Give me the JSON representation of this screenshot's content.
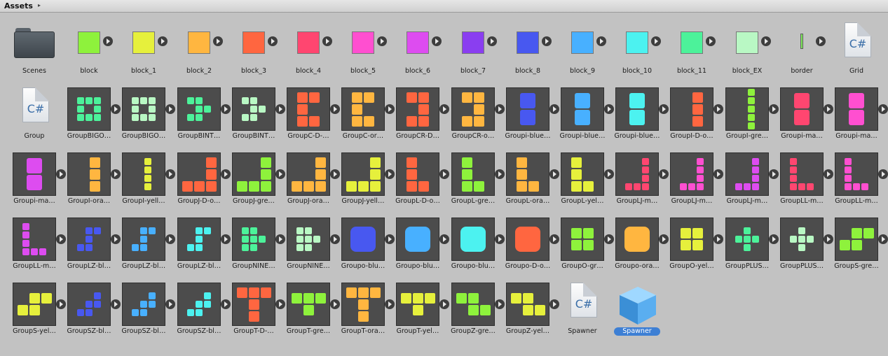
{
  "breadcrumb": {
    "label": "Assets",
    "arrow_icon": "chevron-right-icon"
  },
  "colors": {
    "block": "#8ef23c",
    "block_1": "#e6f03c",
    "block_2": "#ffb640",
    "block_3": "#ff6640",
    "block_4": "#ff4670",
    "block_5": "#ff4fd0",
    "block_6": "#dd4cf0",
    "block_7": "#8a3ef0",
    "block_8": "#4858f0",
    "block_9": "#48b0ff",
    "block_10": "#4cf2f0",
    "block_11": "#4cf29a",
    "block_EX": "#b9f8c4",
    "border": "#7ee85a",
    "selection": "#3d7fd4"
  },
  "assets": [
    {
      "label": "Scenes",
      "kind": "folder"
    },
    {
      "label": "block",
      "kind": "swatch",
      "color": "#8ef23c"
    },
    {
      "label": "block_1",
      "kind": "swatch",
      "color": "#e6f03c"
    },
    {
      "label": "block_2",
      "kind": "swatch",
      "color": "#ffb640"
    },
    {
      "label": "block_3",
      "kind": "swatch",
      "color": "#ff6640"
    },
    {
      "label": "block_4",
      "kind": "swatch",
      "color": "#ff4670"
    },
    {
      "label": "block_5",
      "kind": "swatch",
      "color": "#ff4fd0"
    },
    {
      "label": "block_6",
      "kind": "swatch",
      "color": "#dd4cf0"
    },
    {
      "label": "block_7",
      "kind": "swatch",
      "color": "#8a3ef0"
    },
    {
      "label": "block_8",
      "kind": "swatch",
      "color": "#4858f0"
    },
    {
      "label": "block_9",
      "kind": "swatch",
      "color": "#48b0ff"
    },
    {
      "label": "block_10",
      "kind": "swatch",
      "color": "#4cf2f0"
    },
    {
      "label": "block_11",
      "kind": "swatch",
      "color": "#4cf29a"
    },
    {
      "label": "block_EX",
      "kind": "swatch",
      "color": "#b9f8c4"
    },
    {
      "label": "border",
      "kind": "border"
    },
    {
      "label": "Grid",
      "kind": "script"
    },
    {
      "label": "Group",
      "kind": "script"
    },
    {
      "label": "GroupBIGO…",
      "kind": "tile",
      "shape": "bigo",
      "color": "#4cf29a"
    },
    {
      "label": "GroupBIGO…",
      "kind": "tile",
      "shape": "bigo",
      "color": "#b9f8c4"
    },
    {
      "label": "GroupBINT…",
      "kind": "tile",
      "shape": "bint",
      "color": "#4cf29a"
    },
    {
      "label": "GroupBINT…",
      "kind": "tile",
      "shape": "bint",
      "color": "#b9f8c4"
    },
    {
      "label": "GroupC-D-…",
      "kind": "tile",
      "shape": "c",
      "color": "#ff6640"
    },
    {
      "label": "GroupC-or…",
      "kind": "tile",
      "shape": "c",
      "color": "#ffb640"
    },
    {
      "label": "GroupCR-D…",
      "kind": "tile",
      "shape": "cr",
      "color": "#ff6640"
    },
    {
      "label": "GroupCR-o…",
      "kind": "tile",
      "shape": "cr",
      "color": "#ffb640"
    },
    {
      "label": "Groupi-blue…",
      "kind": "tile",
      "shape": "i2",
      "color": "#4858f0"
    },
    {
      "label": "Groupi-blue…",
      "kind": "tile",
      "shape": "i2",
      "color": "#48b0ff"
    },
    {
      "label": "Groupi-blue…",
      "kind": "tile",
      "shape": "i2",
      "color": "#4cf2f0"
    },
    {
      "label": "GroupI-D-o…",
      "kind": "tile",
      "shape": "i3",
      "color": "#ff6640"
    },
    {
      "label": "GroupI-gre…",
      "kind": "tile",
      "shape": "i5",
      "color": "#8ef23c"
    },
    {
      "label": "Groupi-ma…",
      "kind": "tile",
      "shape": "i2",
      "color": "#ff4670"
    },
    {
      "label": "Groupi-ma…",
      "kind": "tile",
      "shape": "i2",
      "color": "#ff4fd0"
    },
    {
      "label": "Groupi-ma…",
      "kind": "tile",
      "shape": "i2",
      "color": "#dd4cf0"
    },
    {
      "label": "GroupI-ora…",
      "kind": "tile",
      "shape": "i3",
      "color": "#ffb640"
    },
    {
      "label": "GroupI-yell…",
      "kind": "tile",
      "shape": "i4",
      "color": "#e6f03c"
    },
    {
      "label": "GroupJ-D-o…",
      "kind": "tile",
      "shape": "j",
      "color": "#ff6640"
    },
    {
      "label": "GroupJ-gre…",
      "kind": "tile",
      "shape": "j",
      "color": "#8ef23c"
    },
    {
      "label": "GroupJ-ora…",
      "kind": "tile",
      "shape": "j",
      "color": "#ffb640"
    },
    {
      "label": "GroupJ-yell…",
      "kind": "tile",
      "shape": "j",
      "color": "#e6f03c"
    },
    {
      "label": "GroupL-D-o…",
      "kind": "tile",
      "shape": "l",
      "color": "#ff6640"
    },
    {
      "label": "GroupL-gre…",
      "kind": "tile",
      "shape": "l",
      "color": "#8ef23c"
    },
    {
      "label": "GroupL-ora…",
      "kind": "tile",
      "shape": "l",
      "color": "#ffb640"
    },
    {
      "label": "GroupL-yel…",
      "kind": "tile",
      "shape": "l",
      "color": "#e6f03c"
    },
    {
      "label": "GroupLJ-m…",
      "kind": "tile",
      "shape": "lj",
      "color": "#ff4670"
    },
    {
      "label": "GroupLJ-m…",
      "kind": "tile",
      "shape": "lj",
      "color": "#ff4fd0"
    },
    {
      "label": "GroupLJ-m…",
      "kind": "tile",
      "shape": "lj",
      "color": "#dd4cf0"
    },
    {
      "label": "GroupLL-m…",
      "kind": "tile",
      "shape": "ll",
      "color": "#ff4670"
    },
    {
      "label": "GroupLL-m…",
      "kind": "tile",
      "shape": "ll",
      "color": "#ff4fd0"
    },
    {
      "label": "GroupLL-m…",
      "kind": "tile",
      "shape": "ll",
      "color": "#dd4cf0"
    },
    {
      "label": "GroupLZ-bl…",
      "kind": "tile",
      "shape": "lz",
      "color": "#4858f0"
    },
    {
      "label": "GroupLZ-bl…",
      "kind": "tile",
      "shape": "lz",
      "color": "#48b0ff"
    },
    {
      "label": "GroupLZ-bl…",
      "kind": "tile",
      "shape": "lz",
      "color": "#4cf2f0"
    },
    {
      "label": "GroupNINE…",
      "kind": "tile",
      "shape": "nine",
      "color": "#4cf29a"
    },
    {
      "label": "GroupNINE…",
      "kind": "tile",
      "shape": "nine",
      "color": "#b9f8c4"
    },
    {
      "label": "Groupo-blu…",
      "kind": "tile",
      "shape": "o1",
      "color": "#4858f0"
    },
    {
      "label": "Groupo-blu…",
      "kind": "tile",
      "shape": "o1",
      "color": "#48b0ff"
    },
    {
      "label": "Groupo-blu…",
      "kind": "tile",
      "shape": "o1",
      "color": "#4cf2f0"
    },
    {
      "label": "Groupo-D-o…",
      "kind": "tile",
      "shape": "o1",
      "color": "#ff6640"
    },
    {
      "label": "GroupO-gr…",
      "kind": "tile",
      "shape": "o4",
      "color": "#8ef23c"
    },
    {
      "label": "Groupo-ora…",
      "kind": "tile",
      "shape": "o1",
      "color": "#ffb640"
    },
    {
      "label": "GroupO-yel…",
      "kind": "tile",
      "shape": "o4",
      "color": "#e6f03c"
    },
    {
      "label": "GroupPLUS…",
      "kind": "tile",
      "shape": "plus",
      "color": "#4cf29a"
    },
    {
      "label": "GroupPLUS…",
      "kind": "tile",
      "shape": "plus",
      "color": "#b9f8c4"
    },
    {
      "label": "GroupS-gre…",
      "kind": "tile",
      "shape": "s",
      "color": "#8ef23c"
    },
    {
      "label": "GroupS-yel…",
      "kind": "tile",
      "shape": "s",
      "color": "#e6f03c"
    },
    {
      "label": "GroupSZ-bl…",
      "kind": "tile",
      "shape": "sz",
      "color": "#4858f0"
    },
    {
      "label": "GroupSZ-bl…",
      "kind": "tile",
      "shape": "sz",
      "color": "#48b0ff"
    },
    {
      "label": "GroupSZ-bl…",
      "kind": "tile",
      "shape": "sz",
      "color": "#4cf2f0"
    },
    {
      "label": "GroupT-D-…",
      "kind": "tile",
      "shape": "tbig",
      "color": "#ff6640"
    },
    {
      "label": "GroupT-gre…",
      "kind": "tile",
      "shape": "t",
      "color": "#8ef23c"
    },
    {
      "label": "GroupT-ora…",
      "kind": "tile",
      "shape": "tbig",
      "color": "#ffb640"
    },
    {
      "label": "GroupT-yel…",
      "kind": "tile",
      "shape": "t",
      "color": "#e6f03c"
    },
    {
      "label": "GroupZ-gre…",
      "kind": "tile",
      "shape": "z",
      "color": "#8ef23c"
    },
    {
      "label": "GroupZ-yel…",
      "kind": "tile",
      "shape": "z",
      "color": "#e6f03c"
    },
    {
      "label": "Spawner",
      "kind": "script"
    },
    {
      "label": "Spawner",
      "kind": "prefab",
      "selected": true
    }
  ]
}
